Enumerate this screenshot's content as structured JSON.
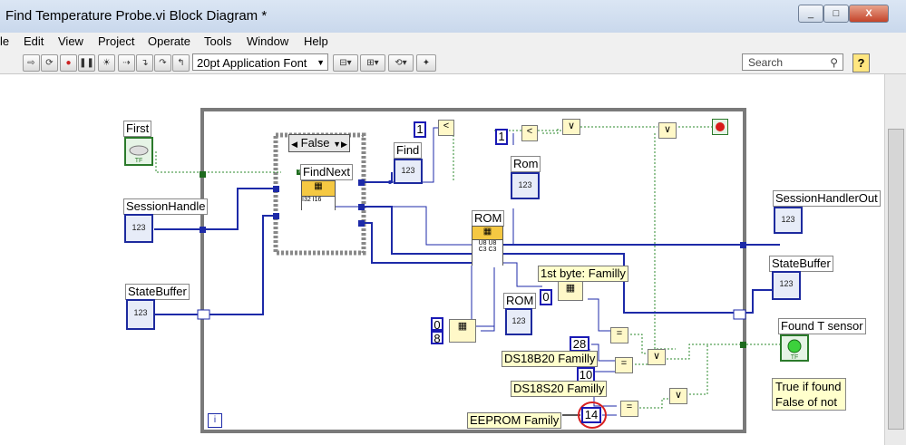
{
  "window": {
    "title": "Find Temperature Probe.vi Block Diagram *",
    "minimize": "_",
    "maximize": "□",
    "close": "X"
  },
  "menu": [
    "le",
    "Edit",
    "View",
    "Project",
    "Operate",
    "Tools",
    "Window",
    "Help"
  ],
  "toolbar": {
    "font": "20pt Application Font",
    "search_placeholder": "Search",
    "help": "?"
  },
  "diagram": {
    "controls": {
      "first": "First",
      "session_handle": "SessionHandle",
      "state_buffer": "StateBuffer"
    },
    "case_selector": "False",
    "nodes": {
      "find_next": "FindNext",
      "rom_node": "ROM",
      "find": "Find",
      "rom_indicator_1": "Rom",
      "rom_indicator_2": "ROM"
    },
    "constants": {
      "one_a": "1",
      "one_b": "1",
      "zero": "0",
      "eight": "8",
      "zero_b": "0",
      "c28": "28",
      "c10": "10",
      "c14": "14"
    },
    "labels": {
      "first_byte": "1st byte: Familly",
      "ds18b20": "DS18B20 Familly",
      "ds18s20": "DS18S20 Familly",
      "eeprom": "EEPROM Family",
      "session_out": "SessionHandlerOut",
      "state_buffer_out": "StateBuffer",
      "found_t_sensor": "Found T sensor",
      "comment_line1": "True if found",
      "comment_line2": "False of not"
    },
    "primitives": {
      "lt": "<",
      "eq": "=",
      "or": "∨"
    },
    "loop_index": "i"
  },
  "colors": {
    "wire_blue": "#1d2aa8",
    "wire_green": "#2b8a2b",
    "orange_node": "#f5c842",
    "highlight_circle": "#d82020"
  }
}
